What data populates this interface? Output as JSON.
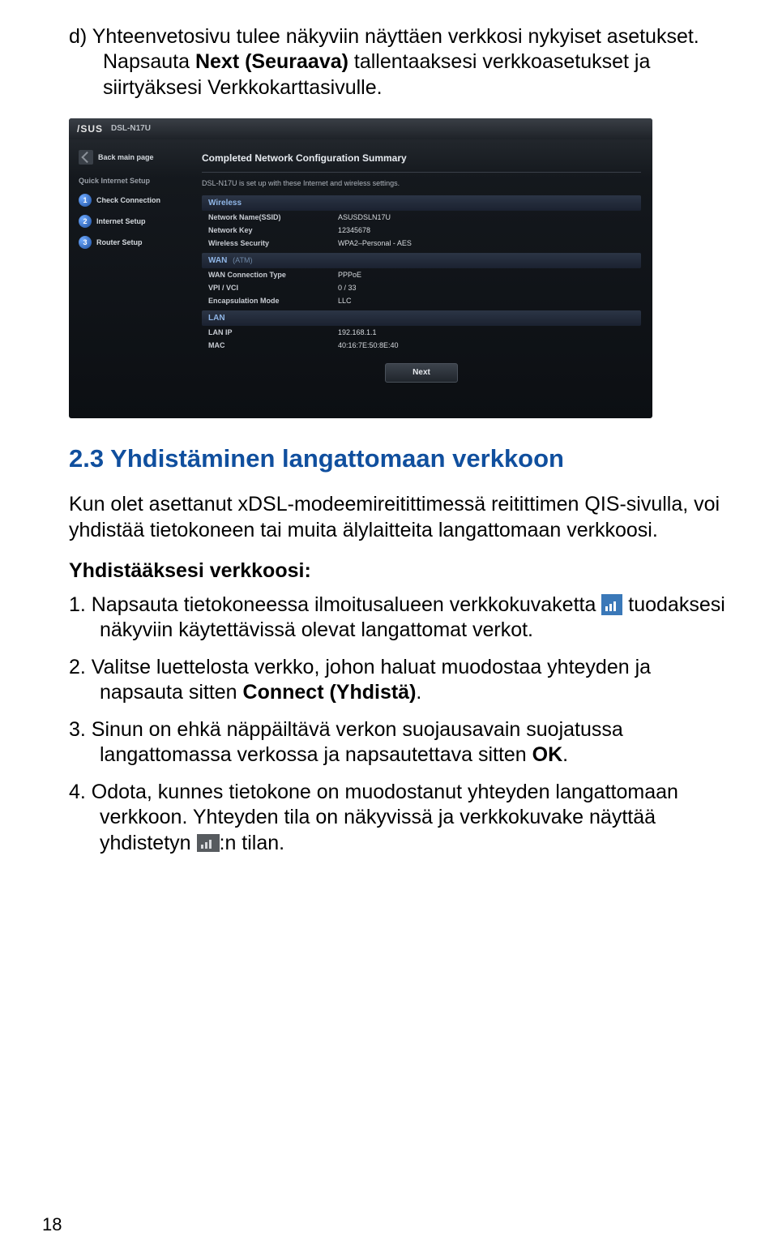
{
  "intro": {
    "prefix": "d)  ",
    "t1": "Yhteenvetosivu tulee näkyviin näyttäen verkkosi nykyiset asetukset. Napsauta ",
    "bold": "Next (Seuraava)",
    "t2": " tallentaaksesi verkkoasetukset ja siirtyäksesi Verkkokarttasivulle."
  },
  "router": {
    "brand": "/SUS",
    "model": "DSL-N17U",
    "sidebar": {
      "back": "Back main page",
      "heading": "Quick Internet Setup",
      "steps": [
        {
          "n": "1",
          "label": "Check Connection"
        },
        {
          "n": "2",
          "label": "Internet Setup"
        },
        {
          "n": "3",
          "label": "Router Setup"
        }
      ]
    },
    "panel": {
      "title": "Completed Network Configuration Summary",
      "subtitle": "DSL-N17U is set up with these Internet and wireless settings.",
      "sections": [
        {
          "header": "Wireless",
          "sub": "",
          "rows": [
            {
              "k": "Network Name(SSID)",
              "v": "ASUSDSLN17U"
            },
            {
              "k": "Network Key",
              "v": "12345678"
            },
            {
              "k": "Wireless Security",
              "v": "WPA2–Personal - AES"
            }
          ]
        },
        {
          "header": "WAN",
          "sub": "(ATM)",
          "rows": [
            {
              "k": "WAN Connection Type",
              "v": "PPPoE"
            },
            {
              "k": "VPI / VCI",
              "v": "0 / 33"
            },
            {
              "k": "Encapsulation Mode",
              "v": "LLC"
            }
          ]
        },
        {
          "header": "LAN",
          "sub": "",
          "rows": [
            {
              "k": "LAN IP",
              "v": "192.168.1.1"
            },
            {
              "k": "MAC",
              "v": "40:16:7E:50:8E:40"
            }
          ]
        }
      ],
      "next": "Next"
    }
  },
  "heading": "2.3   Yhdistäminen langattomaan verkkoon",
  "body": "Kun olet asettanut xDSL-modeemireitittimessä reitittimen QIS-sivulla, voi yhdistää tietokoneen tai muita älylaitteita langattomaan verkkoosi.",
  "subhead": "Yhdistääksesi verkkoosi:",
  "steps": {
    "s1a": "1.  Napsauta tietokoneessa ilmoitusalueen verkkokuvaketta ",
    "s1b": " tuodaksesi näkyviin käytettävissä olevat langattomat verkot.",
    "s2a": "2.  Valitse luettelosta verkko, johon haluat muodostaa yhteyden ja napsauta sitten ",
    "s2bold": "Connect (Yhdistä)",
    "s2b": ".",
    "s3a": "3.  Sinun on ehkä näppäiltävä verkon suojausavain suojatussa langattomassa verkossa ja napsautettava sitten ",
    "s3bold": "OK",
    "s3b": ".",
    "s4a": "4.  Odota, kunnes tietokone on muodostanut yhteyden langattomaan verkkoon. Yhteyden tila on näkyvissä ja verkkokuvake näyttää yhdistetyn ",
    "s4b": ":n tilan."
  },
  "pagenum": "18"
}
